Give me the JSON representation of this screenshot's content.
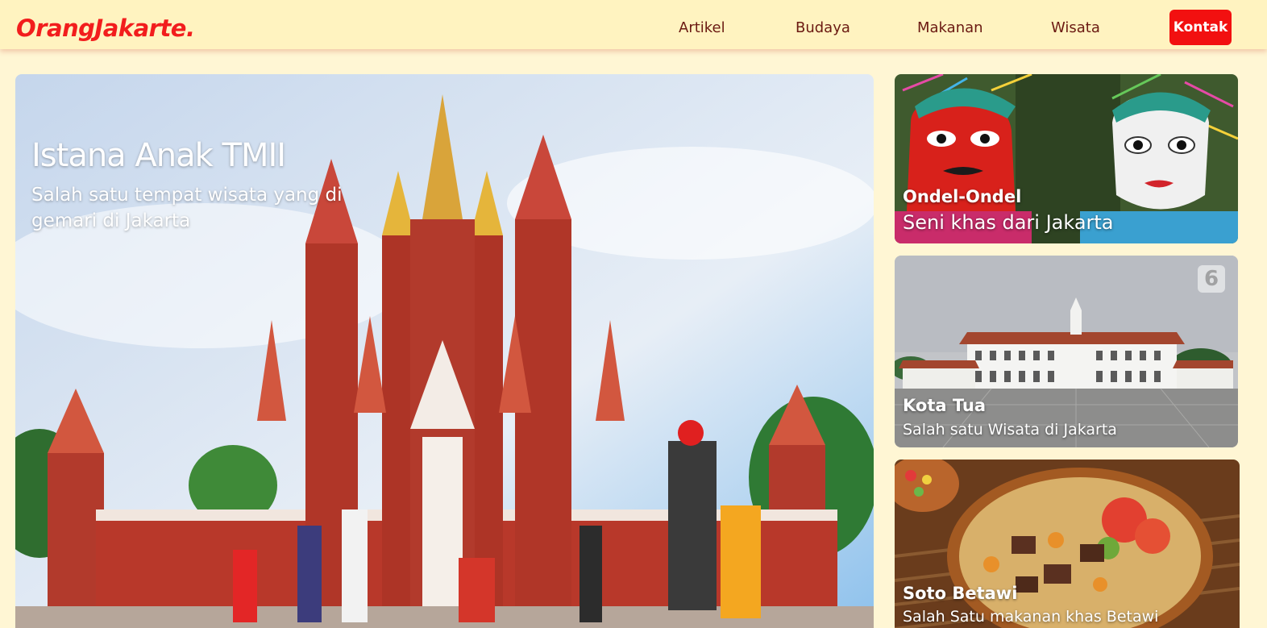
{
  "brand": "OrangJakarte.",
  "nav": {
    "artikel": "Artikel",
    "budaya": "Budaya",
    "makanan": "Makanan",
    "wisata": "Wisata",
    "kontak": "Kontak"
  },
  "hero": {
    "title": "Istana Anak TMII",
    "subtitle": "Salah satu tempat wisata yang di gemari di Jakarta"
  },
  "cards": [
    {
      "title": "Ondel-Ondel",
      "subtitle": "Seni khas dari Jakarta"
    },
    {
      "title": "Kota Tua",
      "subtitle": "Salah satu Wisata di Jakarta",
      "badge": "6"
    },
    {
      "title": "Soto Betawi",
      "subtitle": "Salah Satu makanan khas Betawi"
    }
  ],
  "colors": {
    "accent": "#f21d1d",
    "nav_bg": "#fff3c0",
    "page_bg": "#fff6d4",
    "nav_text": "#6b1a12"
  }
}
